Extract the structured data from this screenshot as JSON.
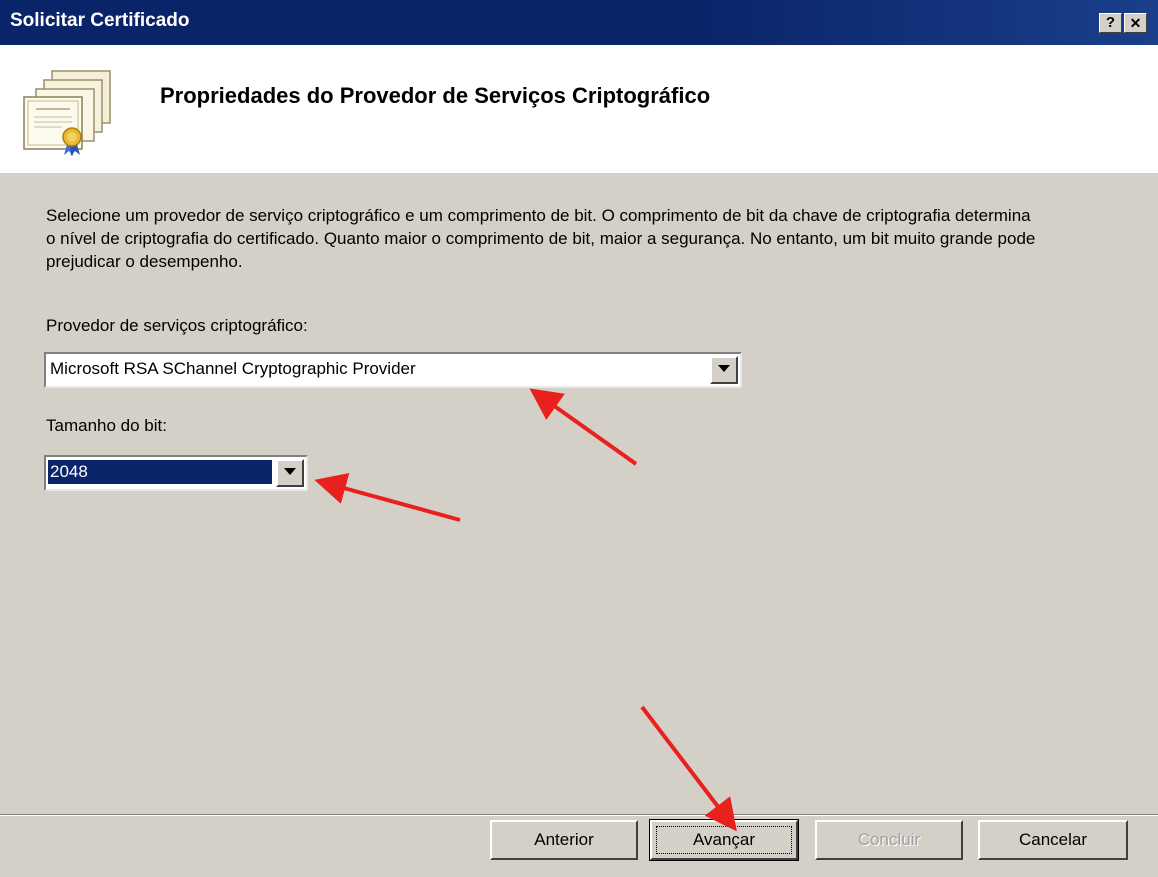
{
  "window": {
    "title": "Solicitar Certificado",
    "help_button": "?",
    "close_button": "✕"
  },
  "header": {
    "title": "Propriedades do Provedor de Serviços Criptográfico",
    "icon": "certificate-icon"
  },
  "content": {
    "description": "Selecione um provedor de serviço criptográfico e um comprimento de bit. O comprimento de bit da chave de criptografia determina o nível de criptografia do certificado. Quanto maior o comprimento de bit, maior a segurança. No entanto, um bit muito grande pode prejudicar o desempenho.",
    "provider_label": "Provedor de serviços criptográfico:",
    "provider_value": "Microsoft RSA SChannel Cryptographic Provider",
    "bitsize_label": "Tamanho do bit:",
    "bitsize_value": "2048"
  },
  "buttons": {
    "back": "Anterior",
    "next": "Avançar",
    "finish": "Concluir",
    "cancel": "Cancelar"
  },
  "colors": {
    "titlebar": "#0a246a",
    "dialog_bg": "#d4d0c8",
    "selection": "#0a246a",
    "annotation_arrow": "#e8211f"
  }
}
